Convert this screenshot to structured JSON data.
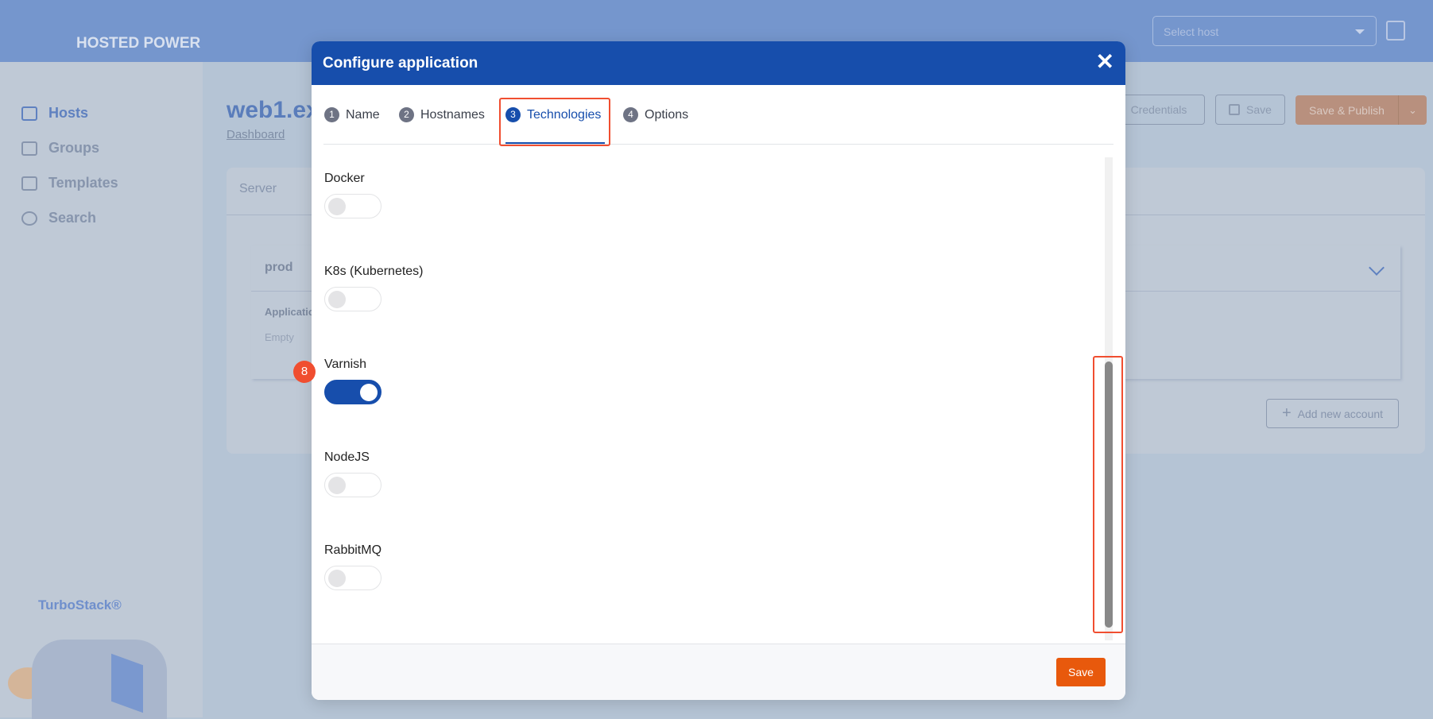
{
  "header": {
    "logo": "HOSTED POWER",
    "host_select_placeholder": "Select host"
  },
  "sidebar": {
    "items": [
      {
        "label": "Hosts",
        "icon": "server-icon",
        "active": true
      },
      {
        "label": "Groups",
        "icon": "layers-icon"
      },
      {
        "label": "Templates",
        "icon": "document-icon"
      },
      {
        "label": "Search",
        "icon": "search-icon"
      }
    ],
    "brand": "TurboStack®"
  },
  "page": {
    "title": "web1.ex",
    "breadcrumb": "Dashboard",
    "buttons": {
      "credentials": "Credentials",
      "save": "Save",
      "save_publish": "Save & Publish"
    },
    "tab": "Server",
    "env": "prod",
    "applications_label": "Applicatio",
    "empty": "Empty",
    "add_account": "Add new account"
  },
  "modal": {
    "title": "Configure application",
    "tabs": [
      {
        "num": "1",
        "label": "Name"
      },
      {
        "num": "2",
        "label": "Hostnames"
      },
      {
        "num": "3",
        "label": "Technologies",
        "active": true
      },
      {
        "num": "4",
        "label": "Options"
      }
    ],
    "technologies": [
      {
        "label": "Docker",
        "enabled": false
      },
      {
        "label": "K8s (Kubernetes)",
        "enabled": false
      },
      {
        "label": "Varnish",
        "enabled": true
      },
      {
        "label": "NodeJS",
        "enabled": false
      },
      {
        "label": "RabbitMQ",
        "enabled": false
      }
    ],
    "save_label": "Save"
  },
  "annotation": {
    "badge": "8"
  },
  "colors": {
    "primary": "#174eac",
    "accent": "#e8590c",
    "highlight": "#f04e30"
  }
}
